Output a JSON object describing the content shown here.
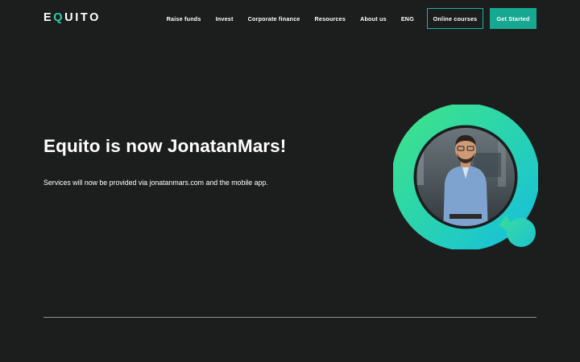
{
  "brand": {
    "logo_prefix": "E",
    "logo_q": "Q",
    "logo_suffix": "UITO"
  },
  "nav": {
    "links": [
      "Raise funds",
      "Invest",
      "Corporate finance",
      "Resources",
      "About us",
      "ENG"
    ],
    "online_courses": "Online courses",
    "get_started": "Get Started"
  },
  "hero": {
    "title": "Equito is now JonatanMars!",
    "subtitle": "Services will now be provided via jonatanmars.com and the mobile app."
  },
  "colors": {
    "background": "#1c1d1d",
    "accent_teal": "#17a892",
    "gradient_green": "#3de08d",
    "gradient_cyan": "#1cc4d8"
  }
}
